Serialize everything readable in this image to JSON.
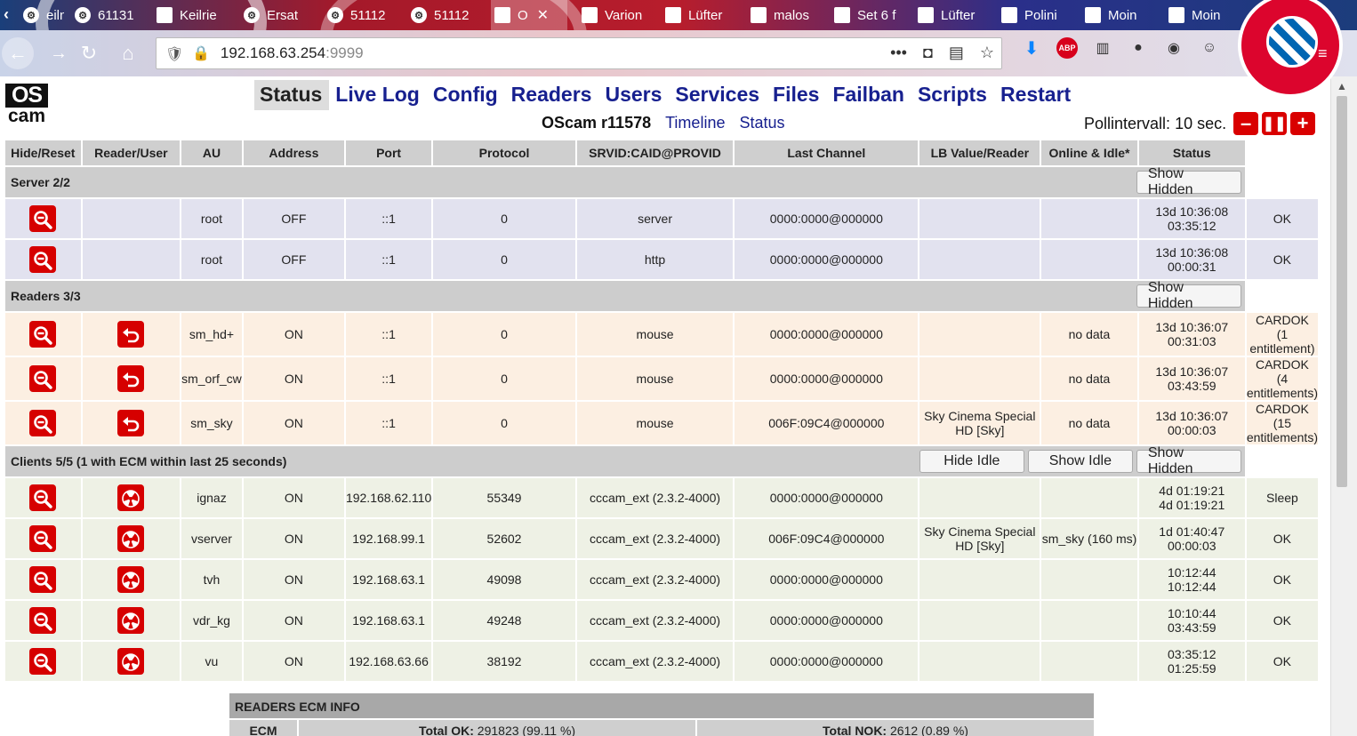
{
  "browser": {
    "tabs": [
      {
        "label": "eilne",
        "icon": "gear-icon"
      },
      {
        "label": "61131",
        "icon": "gear-icon"
      },
      {
        "label": "Keilrie",
        "icon": "logo-icon"
      },
      {
        "label": "Ersat",
        "icon": "gear-icon"
      },
      {
        "label": "51112",
        "icon": "gear-icon"
      },
      {
        "label": "51112",
        "icon": "gear-icon"
      },
      {
        "label": "O",
        "icon": "oscam-icon",
        "active": true
      },
      {
        "label": "Varion",
        "icon": "site-icon"
      },
      {
        "label": "Lüfter",
        "icon": "site-icon"
      },
      {
        "label": "malos",
        "icon": "flag-icon"
      },
      {
        "label": "Set 6 f",
        "icon": "flag-icon"
      },
      {
        "label": "Lüfter",
        "icon": "site-icon"
      },
      {
        "label": "Polini",
        "icon": "ht-icon"
      },
      {
        "label": "Moin",
        "icon": "deb-icon"
      },
      {
        "label": "Moin",
        "icon": "deb-icon"
      }
    ],
    "url_host": "192.168.63.254",
    "url_port": ":9999"
  },
  "logo": {
    "line1": "OS",
    "line2": "cam"
  },
  "menu": [
    "Status",
    "Live Log",
    "Config",
    "Readers",
    "Users",
    "Services",
    "Files",
    "Failban",
    "Scripts",
    "Restart"
  ],
  "subline": {
    "version": "OScam r11578",
    "timeline": "Timeline",
    "status": "Status"
  },
  "poll": {
    "label": "Pollintervall:",
    "value": "10 sec."
  },
  "table": {
    "headers": [
      "Hide/Reset",
      "Reader/User",
      "AU",
      "Address",
      "Port",
      "Protocol",
      "SRVID:CAID@PROVID",
      "Last Channel",
      "LB Value/Reader",
      "Online & Idle*",
      "Status"
    ],
    "groups": [
      {
        "title": "Server 2/2",
        "kind": "srv",
        "buttons": [
          "Show Hidden"
        ],
        "rows": [
          {
            "name": "root",
            "au": "OFF",
            "addr": "::1",
            "port": "0",
            "proto": "server",
            "srvid": "0000:0000@000000",
            "chan": "",
            "lb": "",
            "online": "13d 10:36:08",
            "idle": "03:35:12",
            "status1": "OK",
            "status2": ""
          },
          {
            "name": "root",
            "au": "OFF",
            "addr": "::1",
            "port": "0",
            "proto": "http",
            "srvid": "0000:0000@000000",
            "chan": "",
            "lb": "",
            "online": "13d 10:36:08",
            "idle": "00:00:31",
            "status1": "OK",
            "status2": ""
          }
        ]
      },
      {
        "title": "Readers 3/3",
        "kind": "rdr",
        "buttons": [
          "Show Hidden"
        ],
        "rows": [
          {
            "name": "sm_hd+",
            "au": "ON",
            "addr": "::1",
            "port": "0",
            "proto": "mouse",
            "srvid": "0000:0000@000000",
            "chan": "",
            "lb": "no data",
            "online": "13d 10:36:07",
            "idle": "00:31:03",
            "status1": "CARDOK",
            "status2": "(1 entitlement)"
          },
          {
            "name": "sm_orf_cw",
            "au": "ON",
            "addr": "::1",
            "port": "0",
            "proto": "mouse",
            "srvid": "0000:0000@000000",
            "chan": "",
            "lb": "no data",
            "online": "13d 10:36:07",
            "idle": "03:43:59",
            "status1": "CARDOK",
            "status2": "(4 entitlements)"
          },
          {
            "name": "sm_sky",
            "au": "ON",
            "addr": "::1",
            "port": "0",
            "proto": "mouse",
            "srvid": "006F:09C4@000000",
            "chan": "Sky Cinema Special HD [Sky]",
            "lb": "no data",
            "online": "13d 10:36:07",
            "idle": "00:00:03",
            "status1": "CARDOK",
            "status2": "(15 entitlements)"
          }
        ]
      },
      {
        "title": "Clients 5/5 (1 with ECM within last 25 seconds)",
        "kind": "cli",
        "buttons": [
          "Hide Idle",
          "Show Idle",
          "Show Hidden"
        ],
        "rows": [
          {
            "name": "ignaz",
            "au": "ON",
            "addr": "192.168.62.110",
            "port": "55349",
            "proto": "cccam_ext (2.3.2-4000)",
            "srvid": "0000:0000@000000",
            "chan": "",
            "lb": "",
            "online": "4d 01:19:21",
            "idle": "4d 01:19:21",
            "status1": "Sleep",
            "status2": ""
          },
          {
            "name": "vserver",
            "au": "ON",
            "addr": "192.168.99.1",
            "port": "52602",
            "proto": "cccam_ext (2.3.2-4000)",
            "srvid": "006F:09C4@000000",
            "chan": "Sky Cinema Special HD [Sky]",
            "lb": "sm_sky (160 ms)",
            "online": "1d 01:40:47",
            "idle": "00:00:03",
            "status1": "OK",
            "status2": ""
          },
          {
            "name": "tvh",
            "au": "ON",
            "addr": "192.168.63.1",
            "port": "49098",
            "proto": "cccam_ext (2.3.2-4000)",
            "srvid": "0000:0000@000000",
            "chan": "",
            "lb": "",
            "online": "10:12:44",
            "idle": "10:12:44",
            "status1": "OK",
            "status2": ""
          },
          {
            "name": "vdr_kg",
            "au": "ON",
            "addr": "192.168.63.1",
            "port": "49248",
            "proto": "cccam_ext (2.3.2-4000)",
            "srvid": "0000:0000@000000",
            "chan": "",
            "lb": "",
            "online": "10:10:44",
            "idle": "03:43:59",
            "status1": "OK",
            "status2": ""
          },
          {
            "name": "vu",
            "au": "ON",
            "addr": "192.168.63.66",
            "port": "38192",
            "proto": "cccam_ext (2.3.2-4000)",
            "srvid": "0000:0000@000000",
            "chan": "",
            "lb": "",
            "online": "03:35:12",
            "idle": "01:25:59",
            "status1": "OK",
            "status2": ""
          }
        ]
      }
    ]
  },
  "ecm": {
    "title": "READERS ECM INFO",
    "col1": "ECM",
    "ok_label": "Total OK:",
    "ok_value": "291823 (99.11 %)",
    "nok_label": "Total NOK:",
    "nok_value": "2612 (0.89 %)"
  },
  "colors": {
    "accent": "#d60000",
    "link": "#17208f",
    "server_row": "#e2e2ef",
    "reader_row": "#fcefe2",
    "client_row": "#eef1e5"
  }
}
